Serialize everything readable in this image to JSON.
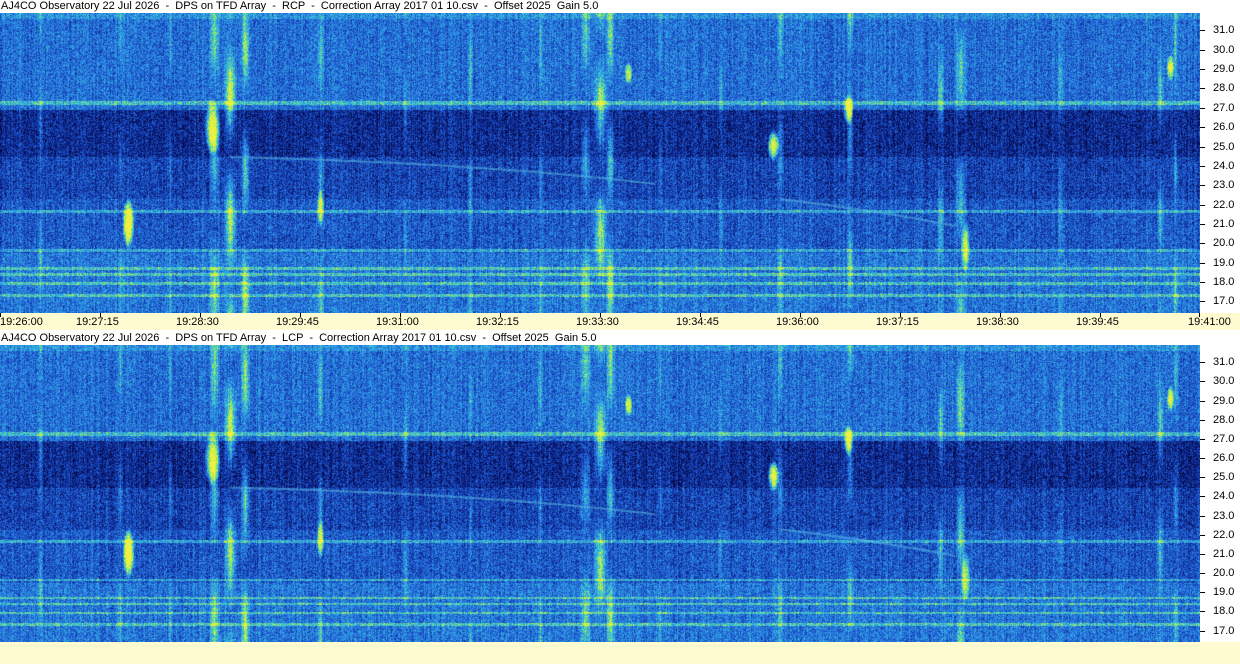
{
  "panels": [
    {
      "title": "AJ4CO Observatory 22 Jul 2026  -  DPS on TFD Array  -  RCP  -  Correction Array 2017 01 10.csv  -  Offset 2025  Gain 5.0",
      "polarization": "RCP"
    },
    {
      "title": "AJ4CO Observatory 22 Jul 2026  -  DPS on TFD Array  -  LCP  -  Correction Array 2017 01 10.csv  -  Offset 2025  Gain 5.0",
      "polarization": "LCP"
    }
  ],
  "chart_data": {
    "type": "heatmap",
    "x_ticks": [
      "19:26:00",
      "19:27:15",
      "19:28:30",
      "19:29:45",
      "19:31:00",
      "19:32:15",
      "19:33:30",
      "19:34:45",
      "19:36:00",
      "19:37:15",
      "19:38:30",
      "19:39:45",
      "19:41:00"
    ],
    "x_range": [
      "19:26:00",
      "19:41:00"
    ],
    "y_ticks": [
      31.0,
      30.0,
      29.0,
      28.0,
      27.0,
      26.0,
      25.0,
      24.0,
      23.0,
      22.0,
      21.0,
      20.0,
      19.0,
      18.0,
      17.0
    ],
    "y_tick_labels": [
      "31.0",
      "30.0",
      "29.0",
      "28.0",
      "27.0",
      "26.0",
      "25.0",
      "24.0",
      "23.0",
      "22.0",
      "21.0",
      "20.0",
      "19.0",
      "18.0",
      "17.0"
    ],
    "y_range": [
      16.4,
      31.9
    ],
    "colormap": [
      "#00002a",
      "#0a1a78",
      "#1a4fc8",
      "#2e8ae6",
      "#36c8d8",
      "#aef04a",
      "#f0f040"
    ]
  }
}
